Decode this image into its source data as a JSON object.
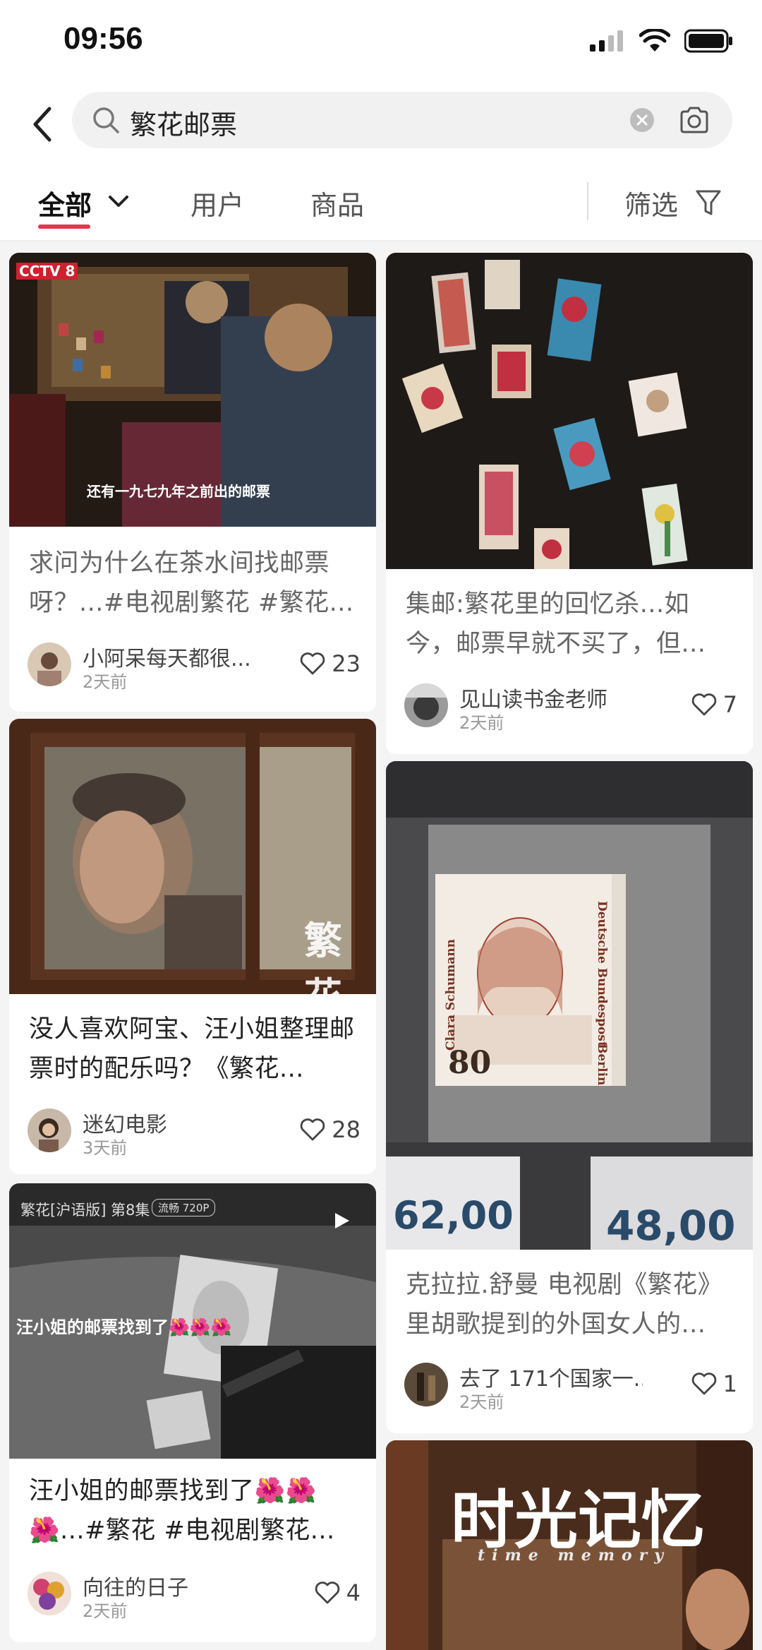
{
  "status": {
    "time": "09:56"
  },
  "search": {
    "query": "繁花邮票"
  },
  "tabs": {
    "all": "全部",
    "users": "用户",
    "products": "商品",
    "filter": "筛选"
  },
  "cards": [
    {
      "title": "求问为什么在茶水间找邮票呀？...#电视剧繁花 #繁花...",
      "author": "小阿呆每天都很...",
      "time": "2天前",
      "likes": "23",
      "img_caption": "还有一九七九年之前出的邮票",
      "img_logo": "CCTV 8"
    },
    {
      "title": "集邮:繁花里的回忆杀...如今，邮票早就不买了，但...",
      "author": "见山读书金老师",
      "time": "2天前",
      "likes": "7"
    },
    {
      "title": "没人喜欢阿宝、汪小姐整理邮票时的配乐吗？《繁花...",
      "author": "迷幻电影",
      "time": "3天前",
      "likes": "28",
      "img_watermark": "繁花"
    },
    {
      "title": "克拉拉.舒曼 电视剧《繁花》里胡歌提到的外国女人的...",
      "author": "去了 171个国家一...",
      "time": "2天前",
      "likes": "1",
      "stamp_name": "Clara Schumann",
      "stamp_country": "Deutsche Bundespost",
      "stamp_city": "Berlin",
      "stamp_value": "80",
      "price_left": "62,00",
      "price_right": "48,00"
    },
    {
      "title": "汪小姐的邮票找到了🌺🌺🌺...#繁花 #电视剧繁花...",
      "author": "向往的日子",
      "time": "2天前",
      "likes": "4",
      "img_header": "繁花[沪语版] 第8集",
      "img_quality": "流畅 720P",
      "img_caption": "汪小姐的邮票找到了🌺🌺🌺"
    },
    {
      "img_title": "时光记忆",
      "img_subtitle": "time memory"
    }
  ],
  "colors": {
    "accent": "#e8344e",
    "background": "#f4f4f4"
  }
}
